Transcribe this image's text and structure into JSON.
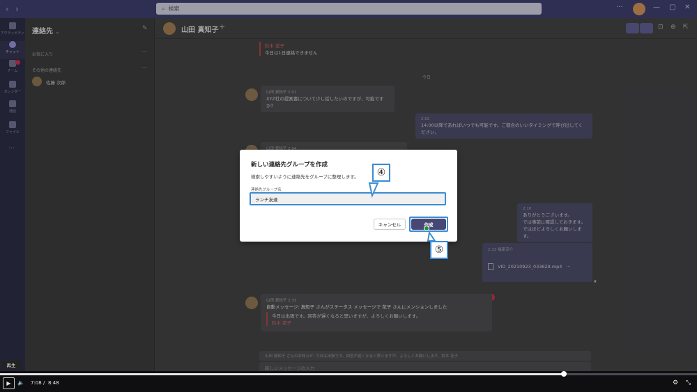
{
  "titlebar": {
    "back": "‹",
    "forward": "›",
    "search_placeholder": "検索",
    "minimize": "—",
    "maximize": "▢",
    "close": "✕"
  },
  "rail": {
    "items": [
      {
        "label": "アクティビティ",
        "icon": "bell-icon"
      },
      {
        "label": "チャット",
        "icon": "chat-icon",
        "active": true
      },
      {
        "label": "チーム",
        "icon": "teams-icon"
      },
      {
        "label": "カレンダー",
        "icon": "calendar-icon"
      },
      {
        "label": "通話",
        "icon": "phone-icon"
      },
      {
        "label": "ファイル",
        "icon": "file-icon"
      }
    ],
    "more": "…"
  },
  "contacts": {
    "title": "連絡先",
    "favorites": "お気に入り",
    "other": "その他の連絡先",
    "contact_name": "佐藤 次郎",
    "dots": "···"
  },
  "chat": {
    "title": "山田 真知子",
    "add": "+",
    "messages": {
      "quote_name": "鈴木 花子",
      "quote_text": "今日は1日連絡できません",
      "today": "今日",
      "m1_meta": "山田 真知子   2:01",
      "m1_text": "XYZ社の提案書について少し話したいのですが、可能ですか？",
      "m2_meta": "2:02",
      "m2_text": "14:00以降であればいつでも可能です。ご都合のいいタイミングで呼び出してください。",
      "m3_meta": "山田 真知子   2:04",
      "m4_meta": "2:10",
      "m4_line1": "ありがとうございます。",
      "m4_line2": "では事前に確認しておきます。",
      "m4_line3": "ではほどよろしくお願いします。",
      "file_meta": "2:22   福家涼介",
      "file_name": "VID_20210923_033629.mp4",
      "m5_meta": "山田 真知子   2:33",
      "m5_text": "自動メッセージ: 真知子 さんがステータス メッセージで 花子 さんにメンションしました",
      "m5_quote": "今日は出張です。回答が遅くなると思いますが、よろしくお願いします。",
      "m5_quote_name": "鈴木 花子",
      "status_line": "山田 真知子 さんのお知らせ: 今日は出張です。回答が遅くなると思いますが、よろしくお願いします。鈴木 花子",
      "compose_placeholder": "新しいメッセージの入力"
    }
  },
  "dialog": {
    "title": "新しい連絡先グループを作成",
    "description": "検索しやすいように連絡先をグループに整理します。",
    "field_label": "連絡先グループ名",
    "field_value": "ランチ友達",
    "cancel": "キャンセル",
    "create": "作成",
    "step4": "④",
    "step5": "⑤"
  },
  "player": {
    "tooltip": "再生",
    "current_time": "7:08",
    "separator": "/",
    "duration": "8:48",
    "progress": 0.809
  },
  "colors": {
    "accent": "#464775",
    "callout": "#3b8bd4"
  }
}
